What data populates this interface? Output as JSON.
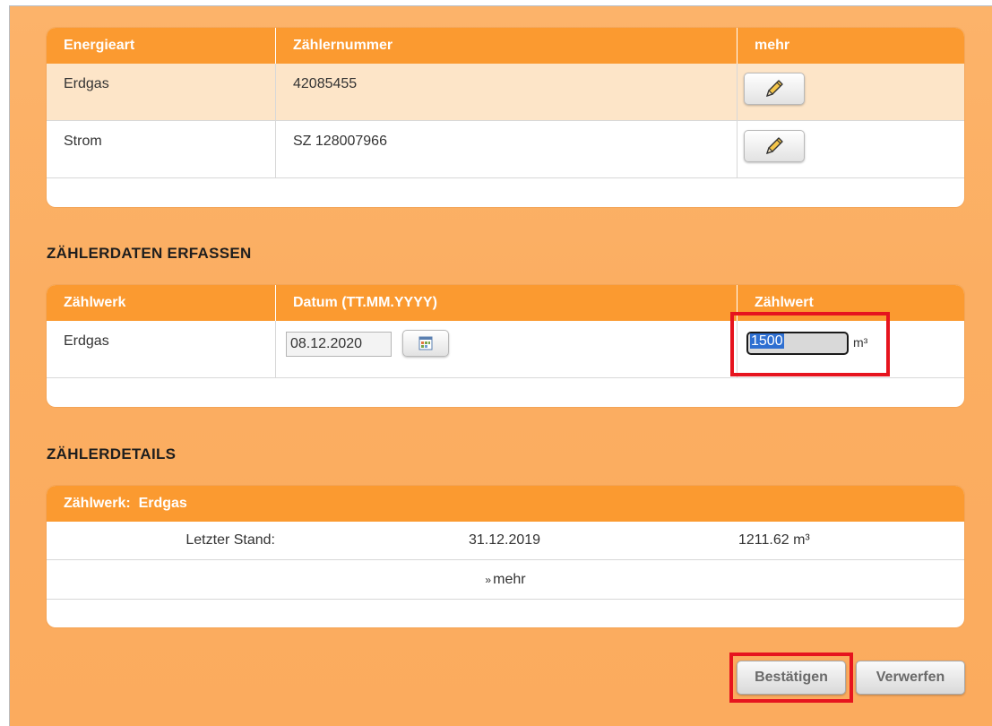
{
  "meters_table": {
    "headers": [
      "Energieart",
      "Zählernummer",
      "mehr"
    ],
    "rows": [
      {
        "energy": "Erdgas",
        "number": "42085455"
      },
      {
        "energy": "Strom",
        "number": "SZ 128007966"
      }
    ]
  },
  "capture_section": {
    "title": "ZÄHLERDATEN ERFASSEN",
    "headers": [
      "Zählwerk",
      "Datum (TT.MM.YYYY)",
      "Zählwert"
    ],
    "row": {
      "register": "Erdgas",
      "date": "08.12.2020",
      "value": "1500",
      "unit": "m³"
    }
  },
  "details_section": {
    "title": "ZÄHLERDETAILS",
    "header": "Zählwerk:  Erdgas",
    "last_reading": {
      "label": "Letzter Stand:",
      "date": "31.12.2019",
      "value": "1211.62 m³"
    },
    "more_label": "mehr"
  },
  "buttons": {
    "confirm": "Bestätigen",
    "discard": "Verwerfen"
  },
  "colors": {
    "header_orange": "#fb9a30",
    "highlight_row": "#fde5c8",
    "annotation_red": "#e6141e"
  }
}
